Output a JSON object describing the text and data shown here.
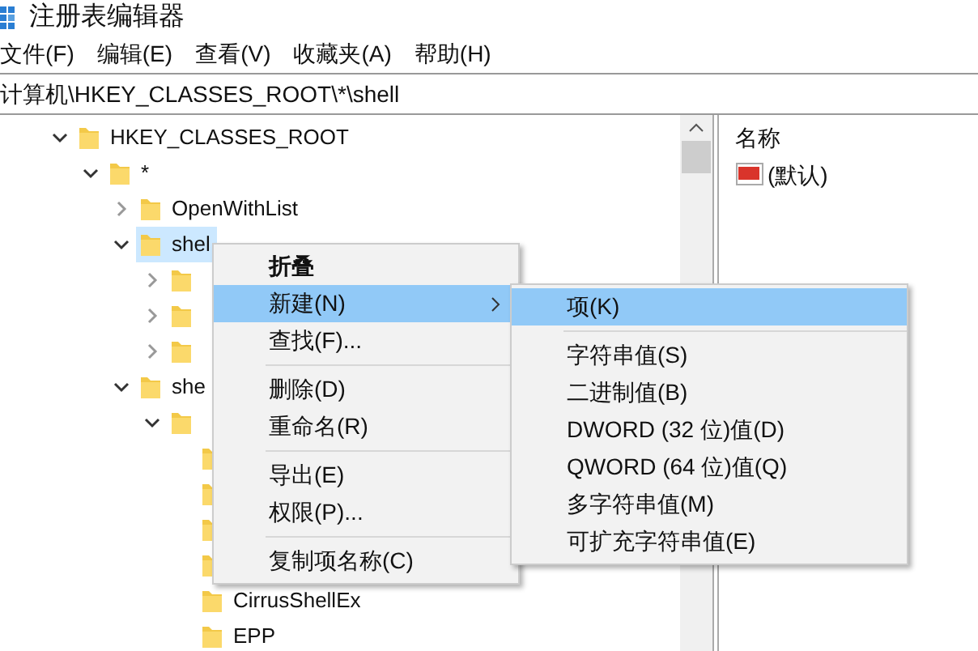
{
  "window": {
    "title": "注册表编辑器"
  },
  "menu_bar": [
    "文件(F)",
    "编辑(E)",
    "查看(V)",
    "收藏夹(A)",
    "帮助(H)"
  ],
  "address": "计算机\\HKEY_CLASSES_ROOT\\*\\shell",
  "tree": [
    {
      "label": "HKEY_CLASSES_ROOT",
      "expanded": true,
      "selected": false,
      "children": [
        {
          "label": "*",
          "expanded": true,
          "selected": false,
          "children": [
            {
              "label": "OpenWithList",
              "expanded": false,
              "selected": false
            },
            {
              "label": "shel",
              "expanded": true,
              "selected": true,
              "children": [
                {
                  "expanded": false,
                  "selected": false
                },
                {
                  "expanded": false,
                  "selected": false
                },
                {
                  "expanded": false,
                  "selected": false
                }
              ]
            },
            {
              "label": "she",
              "expanded": true,
              "selected": false,
              "children": [
                {
                  "expanded": true,
                  "selected": false,
                  "children": [
                    {
                      "selected": false
                    },
                    {
                      "selected": false
                    },
                    {
                      "selected": false
                    },
                    {
                      "selected": false
                    },
                    {
                      "label": "CirrusShellEx",
                      "selected": false
                    },
                    {
                      "label": "EPP",
                      "selected": false
                    }
                  ]
                }
              ]
            }
          ]
        }
      ]
    }
  ],
  "values_pane": {
    "header": "名称",
    "rows": [
      {
        "name": "(默认)"
      }
    ]
  },
  "context_menu": [
    {
      "kind": "item",
      "label": "折叠",
      "bold": true,
      "selected": false
    },
    {
      "kind": "item",
      "label": "新建(N)",
      "submenu": true,
      "selected": true
    },
    {
      "kind": "item",
      "label": "查找(F)...",
      "selected": false
    },
    {
      "kind": "separator"
    },
    {
      "kind": "item",
      "label": "删除(D)",
      "selected": false
    },
    {
      "kind": "item",
      "label": "重命名(R)",
      "selected": false
    },
    {
      "kind": "separator"
    },
    {
      "kind": "item",
      "label": "导出(E)",
      "selected": false
    },
    {
      "kind": "item",
      "label": "权限(P)...",
      "selected": false
    },
    {
      "kind": "separator"
    },
    {
      "kind": "item",
      "label": "复制项名称(C)",
      "selected": false
    }
  ],
  "submenu": [
    {
      "kind": "item",
      "label": "项(K)",
      "selected": true
    },
    {
      "kind": "separator"
    },
    {
      "kind": "item",
      "label": "字符串值(S)",
      "selected": false
    },
    {
      "kind": "item",
      "label": "二进制值(B)",
      "selected": false
    },
    {
      "kind": "item",
      "label": "DWORD (32 位)值(D)",
      "selected": false
    },
    {
      "kind": "item",
      "label": "QWORD (64 位)值(Q)",
      "selected": false
    },
    {
      "kind": "item",
      "label": "多字符串值(M)",
      "selected": false
    },
    {
      "kind": "item",
      "label": "可扩充字符串值(E)",
      "selected": false
    }
  ]
}
